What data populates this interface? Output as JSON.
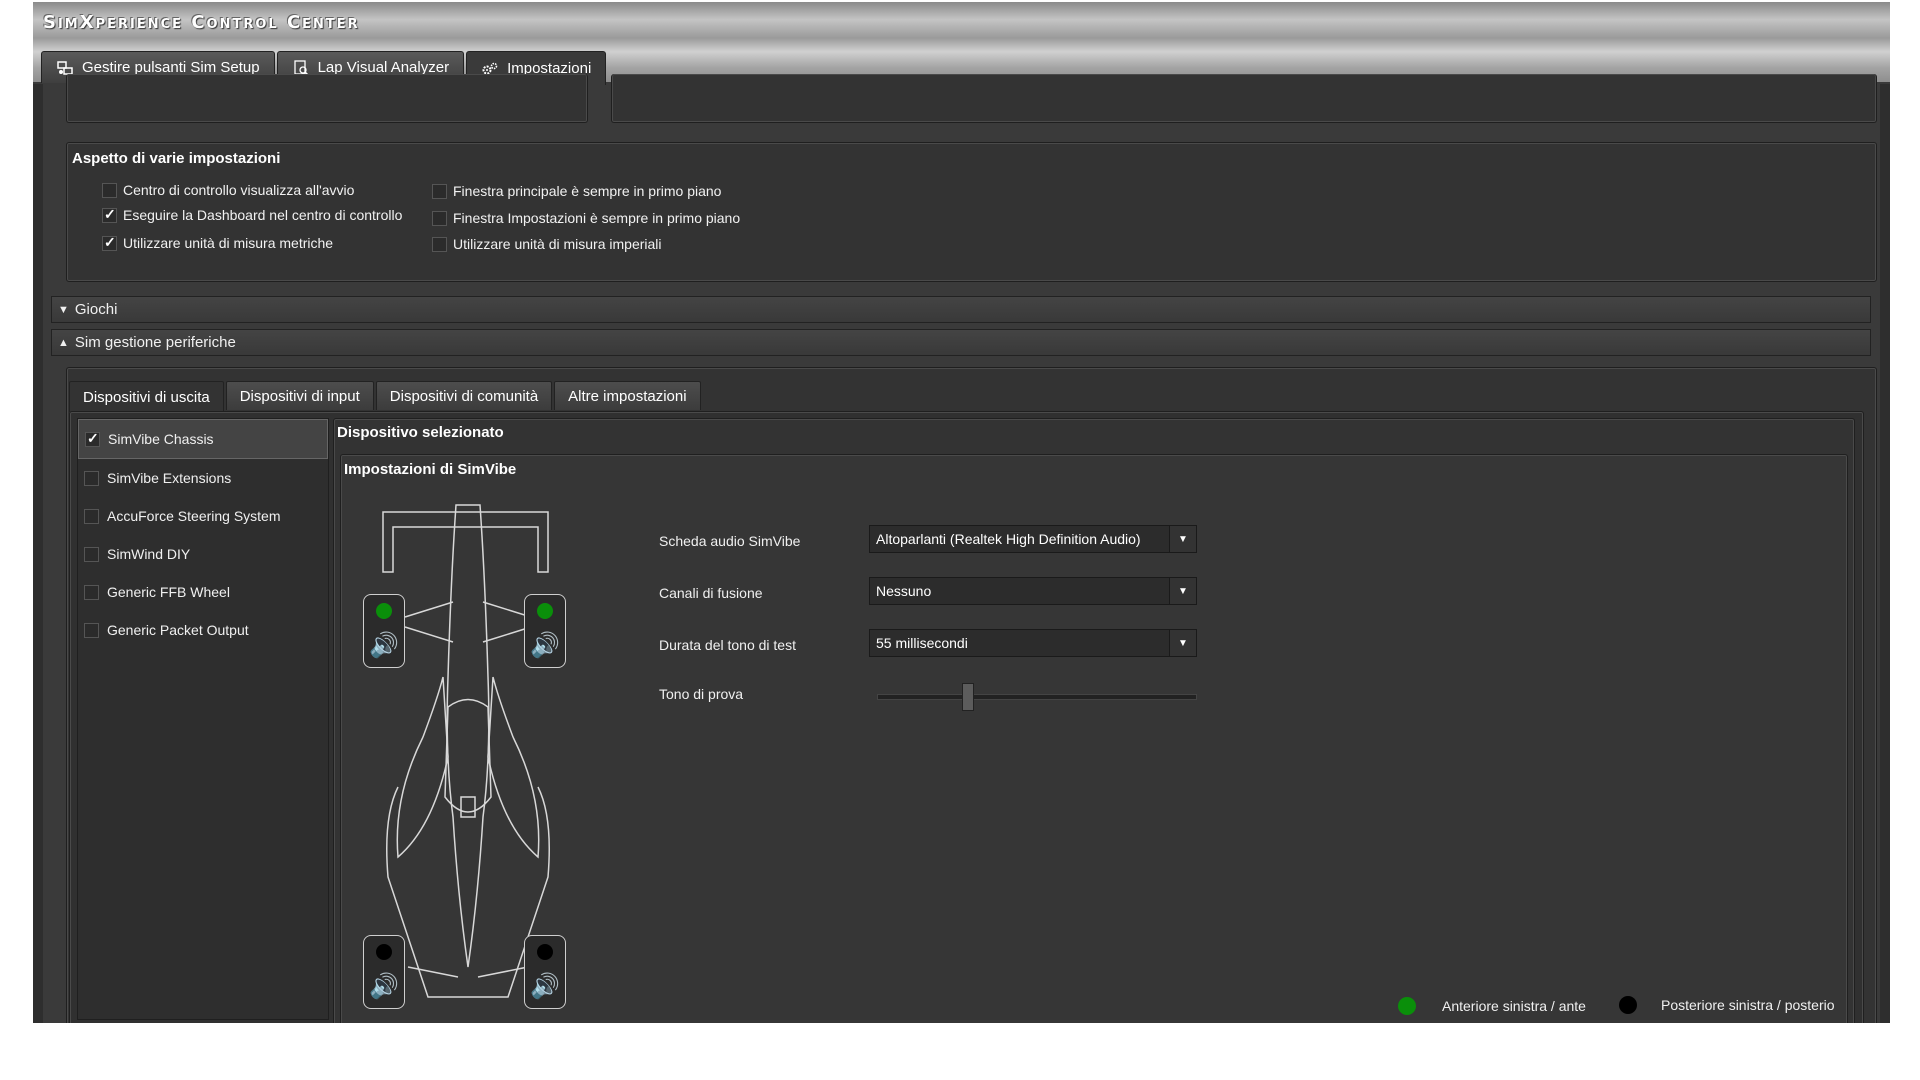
{
  "app": {
    "title": "SimXperience Control Center"
  },
  "main_tabs": [
    {
      "label": "Gestire pulsanti Sim Setup",
      "icon": "buttons-icon"
    },
    {
      "label": "Lap Visual Analyzer",
      "icon": "analyzer-icon"
    },
    {
      "label": "Impostazioni",
      "icon": "gears-icon"
    }
  ],
  "appearance": {
    "title": "Aspetto di varie impostazioni",
    "left": [
      {
        "label": "Centro di controllo visualizza all'avvio",
        "checked": false
      },
      {
        "label": "Eseguire la Dashboard nel centro di controllo",
        "checked": true
      },
      {
        "label": "Utilizzare unità di misura metriche",
        "checked": true
      }
    ],
    "right": [
      {
        "label": "Finestra principale è sempre in primo piano",
        "checked": false
      },
      {
        "label": "Finestra Impostazioni è sempre in primo piano",
        "checked": false
      },
      {
        "label": "Utilizzare unità di misura imperiali",
        "checked": false
      }
    ]
  },
  "sections": {
    "games": "Giochi",
    "peripherals": "Sim gestione periferiche"
  },
  "sub_tabs": [
    "Dispositivi di uscita",
    "Dispositivi di input",
    "Dispositivi di comunità",
    "Altre impostazioni"
  ],
  "devices": [
    {
      "label": "SimVibe Chassis",
      "checked": true,
      "selected": true
    },
    {
      "label": "SimVibe Extensions",
      "checked": false
    },
    {
      "label": "AccuForce Steering System",
      "checked": false
    },
    {
      "label": "SimWind DIY",
      "checked": false
    },
    {
      "label": "Generic FFB Wheel",
      "checked": false
    },
    {
      "label": "Generic Packet Output",
      "checked": false
    }
  ],
  "selected_device": {
    "title": "Dispositivo selezionato",
    "panel_title": "Impostazioni di SimVibe",
    "settings": {
      "sound_card": {
        "label": "Scheda audio SimVibe",
        "value": "Altoparlanti (Realtek High Definition Audio)"
      },
      "channels": {
        "label": "Canali di fusione",
        "value": "Nessuno"
      },
      "duration": {
        "label": "Durata del tono di test",
        "value": "55 millisecondi"
      },
      "test_tone": {
        "label": "Tono di prova",
        "level": 0.28
      }
    },
    "speakers": [
      {
        "name": "front-left",
        "status": "active",
        "color": "#0a8f0a"
      },
      {
        "name": "front-right",
        "status": "active",
        "color": "#0a8f0a"
      },
      {
        "name": "rear-left",
        "status": "inactive",
        "color": "#000000"
      },
      {
        "name": "rear-right",
        "status": "inactive",
        "color": "#000000"
      }
    ],
    "legend": {
      "front": "Anteriore sinistra / ante",
      "rear": "Posteriore sinistra / posterio"
    }
  },
  "colors": {
    "active": "#0a8f0a",
    "inactive": "#000000",
    "panel": "#333333"
  }
}
